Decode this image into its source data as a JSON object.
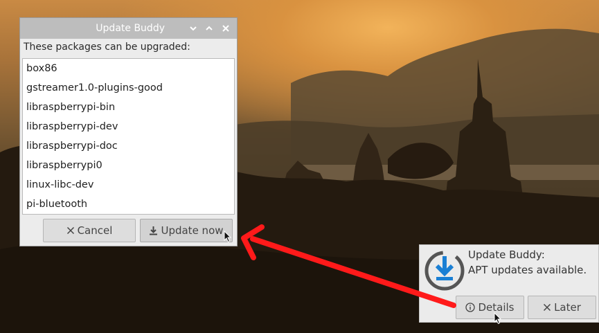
{
  "dialog": {
    "title": "Update Buddy",
    "titlebar_buttons": {
      "minimize": "⌄",
      "maximize": "⌃",
      "close": "✕"
    },
    "label": "These packages can be upgraded:",
    "packages": [
      "box86",
      "gstreamer1.0-plugins-good",
      "libraspberrypi-bin",
      "libraspberrypi-dev",
      "libraspberrypi-doc",
      "libraspberrypi0",
      "linux-libc-dev",
      "pi-bluetooth"
    ],
    "cancel_label": "Cancel",
    "update_label": "Update now"
  },
  "notification": {
    "title": "Update Buddy:",
    "message": "APT updates available.",
    "details_label": "Details",
    "later_label": "Later"
  },
  "icons": {
    "cancel": "close-icon",
    "update": "download-icon",
    "details": "info-icon",
    "later": "close-icon",
    "notification": "update-buddy-logo"
  },
  "colors": {
    "annotation_arrow": "#ff1a1a",
    "logo_blue": "#1a7fd4",
    "logo_ring": "#555555"
  }
}
